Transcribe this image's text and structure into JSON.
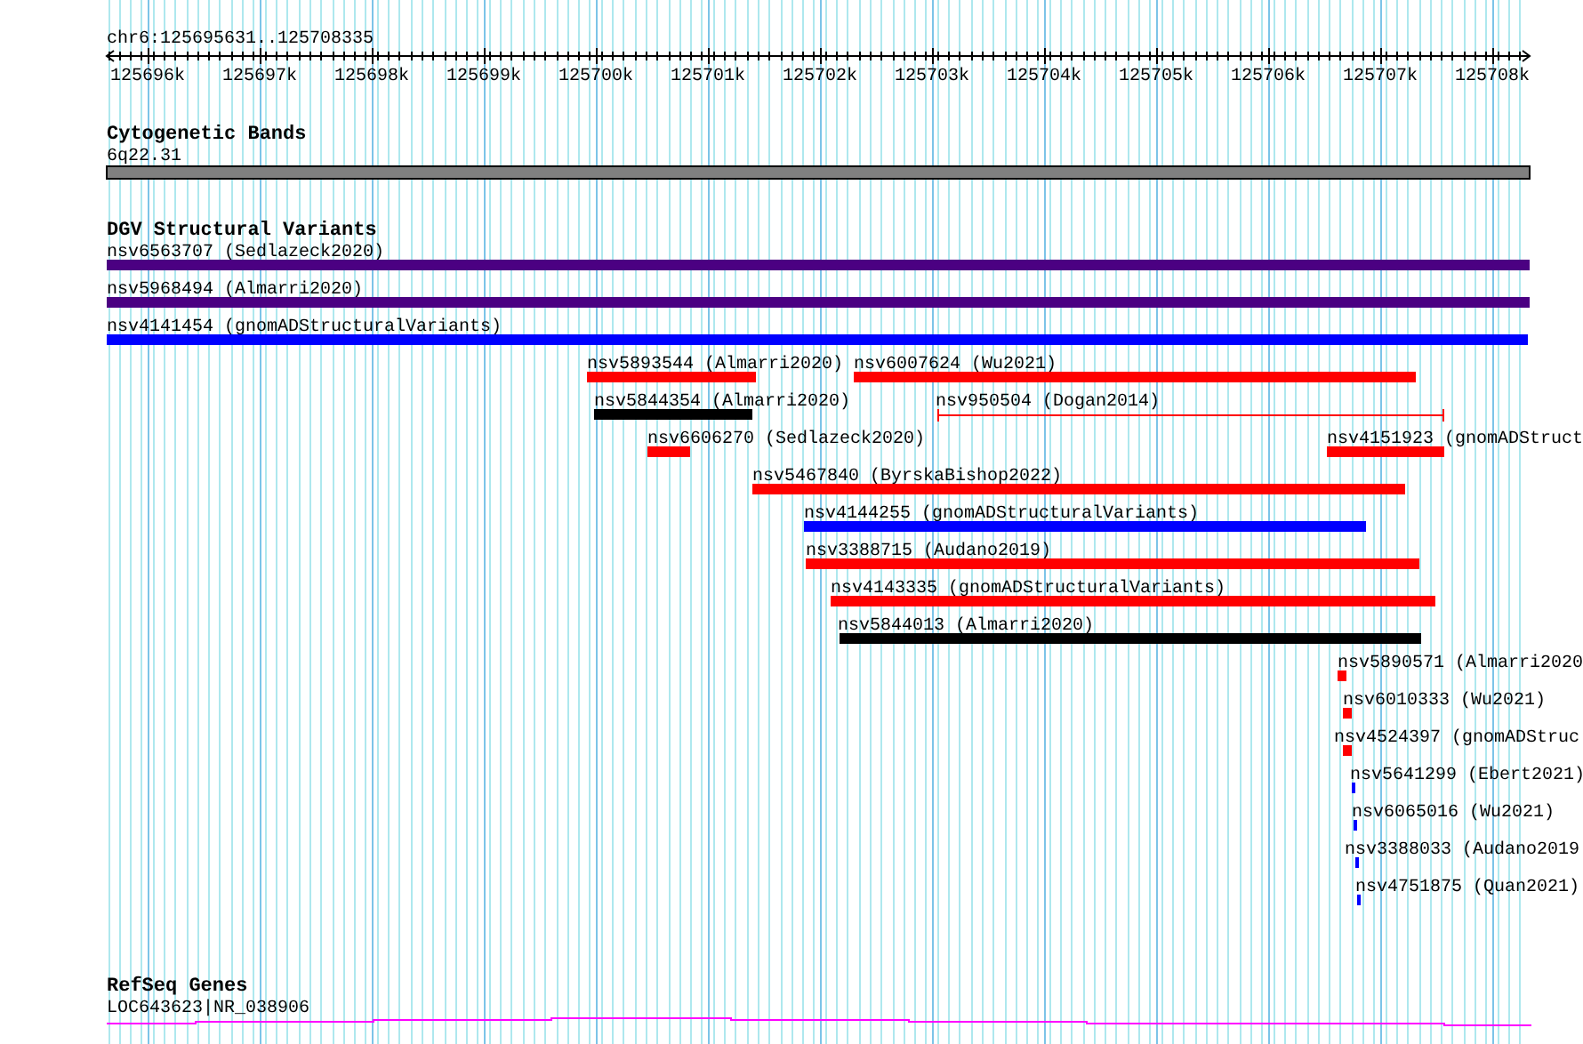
{
  "locus": "chr6:125695631..125708335",
  "ruler": {
    "ticks": [
      "125696k",
      "125697k",
      "125698k",
      "125699k",
      "125700k",
      "125701k",
      "125702k",
      "125703k",
      "125704k",
      "125705k",
      "125706k",
      "125707k",
      "125708k"
    ]
  },
  "tracks": [
    {
      "kind": "bands",
      "title": "Cytogenetic Bands",
      "features": [
        {
          "label": "6q22.31",
          "color": "#808080"
        }
      ]
    },
    {
      "kind": "variants",
      "title": "DGV Structural Variants",
      "features": [
        {
          "label": "nsv6563707 (Sedlazeck2020)",
          "color": "#4b0082",
          "kind": "bar"
        },
        {
          "label": "nsv5968494 (Almarri2020)",
          "color": "#4b0082",
          "kind": "bar"
        },
        {
          "label": "nsv4141454 (gnomADStructuralVariants)",
          "color": "#0000ff",
          "kind": "bar"
        },
        {
          "label": "nsv5893544 (Almarri2020)",
          "color": "#ff0000",
          "kind": "bar"
        },
        {
          "label": "nsv6007624 (Wu2021)",
          "color": "#ff0000",
          "kind": "bar"
        },
        {
          "label": "nsv5844354 (Almarri2020)",
          "color": "#000000",
          "kind": "bar"
        },
        {
          "label": "nsv950504 (Dogan2014)",
          "color": "#ff0000",
          "kind": "interval"
        },
        {
          "label": "nsv6606270 (Sedlazeck2020)",
          "color": "#ff0000",
          "kind": "bar"
        },
        {
          "label": "nsv4151923 (gnomADStruct",
          "color": "#ff0000",
          "kind": "bar"
        },
        {
          "label": "nsv5467840 (ByrskaBishop2022)",
          "color": "#ff0000",
          "kind": "bar"
        },
        {
          "label": "nsv4144255 (gnomADStructuralVariants)",
          "color": "#0000ff",
          "kind": "bar"
        },
        {
          "label": "nsv3388715 (Audano2019)",
          "color": "#ff0000",
          "kind": "bar"
        },
        {
          "label": "nsv4143335 (gnomADStructuralVariants)",
          "color": "#ff0000",
          "kind": "bar"
        },
        {
          "label": "nsv5844013 (Almarri2020)",
          "color": "#000000",
          "kind": "bar"
        },
        {
          "label": "nsv5890571 (Almarri2020",
          "color": "#ff0000",
          "kind": "bar"
        },
        {
          "label": "nsv6010333 (Wu2021)",
          "color": "#ff0000",
          "kind": "bar"
        },
        {
          "label": "nsv4524397 (gnomADStruc",
          "color": "#ff0000",
          "kind": "bar"
        },
        {
          "label": "nsv5641299 (Ebert2021)",
          "color": "#0000ff",
          "kind": "bar"
        },
        {
          "label": "nsv6065016 (Wu2021)",
          "color": "#0000ff",
          "kind": "bar"
        },
        {
          "label": "nsv3388033 (Audano2019",
          "color": "#0000ff",
          "kind": "bar"
        },
        {
          "label": "nsv4751875 (Quan2021)",
          "color": "#0000ff",
          "kind": "bar"
        }
      ]
    },
    {
      "kind": "genes",
      "title": "RefSeq Genes",
      "features": [
        {
          "label": "LOC643623|NR_038906",
          "color": "#ff00ff"
        }
      ]
    }
  ]
}
